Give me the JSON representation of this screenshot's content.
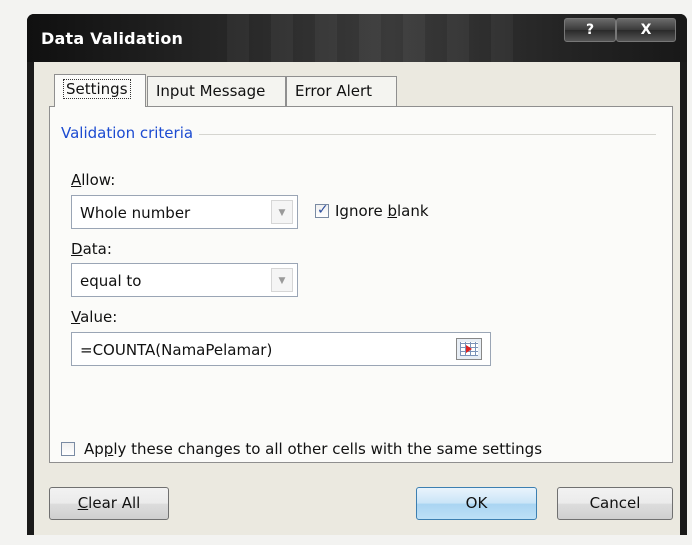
{
  "window": {
    "title": "Data Validation",
    "help": "?",
    "close": "X"
  },
  "tabs": [
    {
      "label": "Settings"
    },
    {
      "label": "Input Message"
    },
    {
      "label": "Error Alert"
    }
  ],
  "settings": {
    "group_label": "Validation criteria",
    "allow": {
      "label_underlined": "A",
      "label_rest": "llow:",
      "value": "Whole number"
    },
    "ignore_blank": {
      "prefix": "Ignore ",
      "underlined": "b",
      "suffix": "lank",
      "checked": true
    },
    "data": {
      "label_underlined": "D",
      "label_rest": "ata:",
      "value": "equal to"
    },
    "value": {
      "label_underlined": "V",
      "label_rest": "alue:",
      "value": "=COUNTA(NamaPelamar)"
    },
    "apply_all": {
      "prefix": "Ap",
      "underlined": "p",
      "suffix": "ly these changes to all other cells with the same settings",
      "checked": false
    }
  },
  "buttons": {
    "clear_underlined": "C",
    "clear_rest": "lear All",
    "ok": "OK",
    "cancel": "Cancel"
  }
}
